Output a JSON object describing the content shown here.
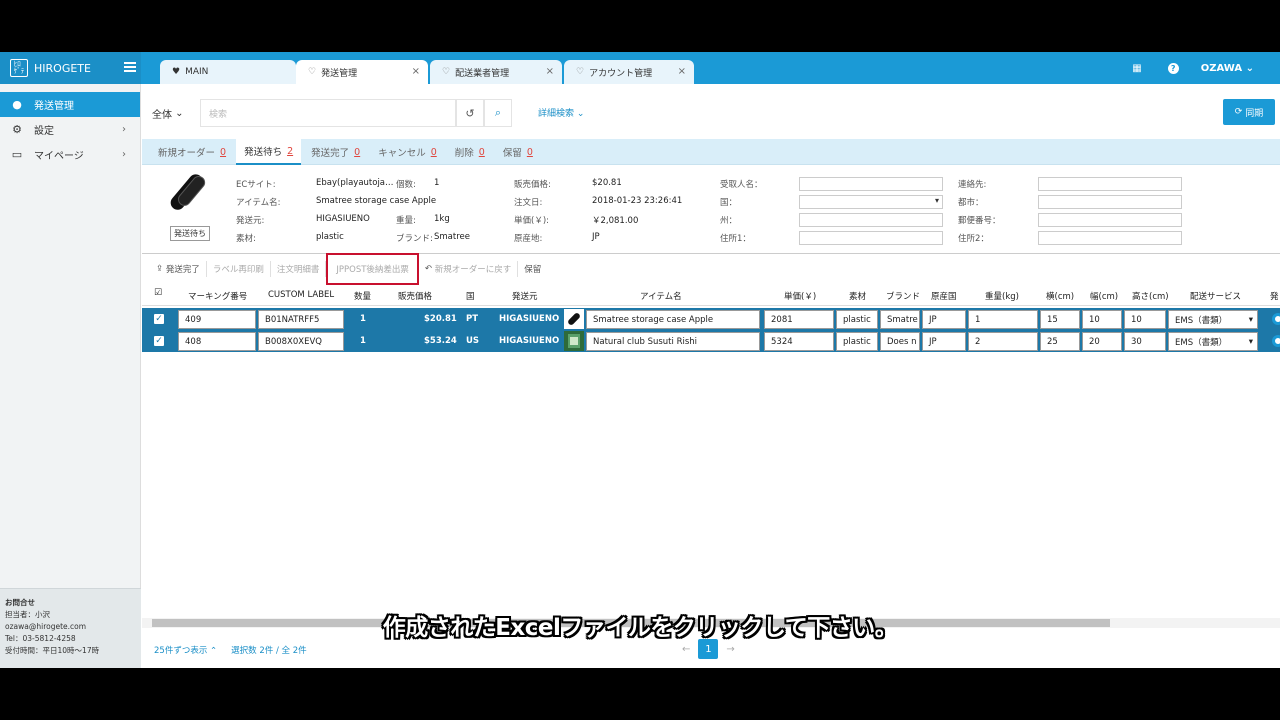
{
  "app": {
    "brand": "HIROGETE",
    "logo_text": "ﾋﾛｹﾞﾃ"
  },
  "tabs": [
    {
      "label": "MAIN"
    },
    {
      "label": "発送管理"
    },
    {
      "label": "配送業者管理"
    },
    {
      "label": "アカウント管理"
    }
  ],
  "topbar": {
    "user": "OZAWA"
  },
  "sidebar": {
    "items": [
      {
        "label": "発送管理"
      },
      {
        "label": "設定"
      },
      {
        "label": "マイページ"
      }
    ],
    "contact": {
      "title": "お問合せ",
      "person": "担当者：小沢",
      "email": "ozawa@hirogete.com",
      "tel": "Tel：03-5812-4258",
      "hours": "受付時間：平日10時～17時"
    }
  },
  "search": {
    "scope": "全体",
    "placeholder": "検索",
    "advanced": "詳細検索",
    "sync": "同期"
  },
  "status_tabs": [
    {
      "label": "新規オーダー",
      "count": "0"
    },
    {
      "label": "発送待ち",
      "count": "2"
    },
    {
      "label": "発送完了",
      "count": "0"
    },
    {
      "label": "キャンセル",
      "count": "0"
    },
    {
      "label": "削除",
      "count": "0"
    },
    {
      "label": "保留",
      "count": "0"
    }
  ],
  "detail": {
    "badge": "発送待ち",
    "ec_site_label": "ECサイト:",
    "ec_site": "Ebay(playautoja…",
    "qty_label": "個数:",
    "qty": "1",
    "item_label": "アイテム名:",
    "item": "Smatree storage case Apple",
    "from_label": "発送元:",
    "from": "HIGASIUENO",
    "weight_label": "重量:",
    "weight": "1kg",
    "material_label": "素材:",
    "material": "plastic",
    "brand_label": "ブランド:",
    "brand": "Smatree",
    "price_label": "販売価格:",
    "price": "$20.81",
    "order_date_label": "注文日:",
    "order_date": "2018-01-23 23:26:41",
    "unit_label": "単価(￥):",
    "unit": "￥2,081.00",
    "origin_label": "原産地:",
    "origin": "JP",
    "recipient_label": "受取人名：",
    "country_label": "国：",
    "state_label": "州：",
    "addr1_label": "住所1：",
    "contact_label": "連絡先:",
    "city_label": "都市：",
    "zip_label": "郵便番号：",
    "addr2_label": "住所2："
  },
  "actions": [
    "発送完了",
    "ラベル再印刷",
    "注文明細書",
    "JPPOST後納差出票",
    "新規オーダーに戻す",
    "保留"
  ],
  "table": {
    "headers": [
      "マーキング番号",
      "CUSTOM LABEL",
      "数量",
      "販売価格",
      "国",
      "発送元",
      "アイテム名",
      "単価(￥)",
      "素材",
      "ブランド",
      "原産国",
      "重量(kg)",
      "横(cm)",
      "幅(cm)",
      "高さ(cm)",
      "配送サービス",
      "発"
    ],
    "rows": [
      {
        "marking": "409",
        "label": "B01NATRFF5",
        "qty": "1",
        "price": "$20.81",
        "country": "PT",
        "from": "HIGASIUENO",
        "item": "Smatree storage case Apple",
        "unit": "2081",
        "material": "plastic",
        "brand": "Smatre",
        "origin": "JP",
        "weight": "1",
        "w": "15",
        "d": "10",
        "h": "10",
        "service": "EMS（書類）"
      },
      {
        "marking": "408",
        "label": "B008X0XEVQ",
        "qty": "1",
        "price": "$53.24",
        "country": "US",
        "from": "HIGASIUENO",
        "item": "Natural club Susuti Rishi",
        "unit": "5324",
        "material": "plastic",
        "brand": "Does n",
        "origin": "JP",
        "weight": "2",
        "w": "25",
        "d": "20",
        "h": "30",
        "service": "EMS（書類）"
      }
    ]
  },
  "footer": {
    "per_page": "25件ずつ表示",
    "selected": "選択数 2件 / 全 2件",
    "page": "1"
  },
  "subtitle": "作成されたExcelファイルをクリックして下さい。",
  "colors": {
    "accent": "#1b9ad6",
    "row": "#1d78a8",
    "count": "#e0463e",
    "highlight": "#c8102e"
  }
}
